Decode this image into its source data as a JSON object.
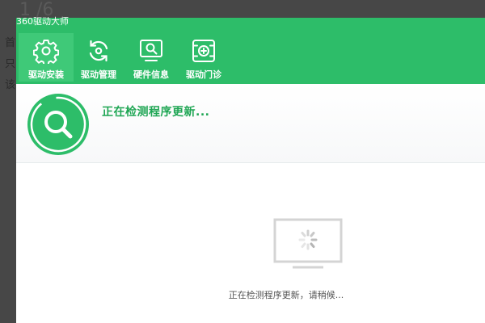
{
  "background_page": {
    "title": "1 /6",
    "lines": [
      "首",
      "只",
      "该"
    ]
  },
  "app": {
    "title": "360驱动大师",
    "nav": [
      {
        "label": "驱动安装",
        "icon": "gear-icon",
        "active": true
      },
      {
        "label": "驱动管理",
        "icon": "refresh-icon",
        "active": false
      },
      {
        "label": "硬件信息",
        "icon": "monitor-search-icon",
        "active": false
      },
      {
        "label": "驱动门诊",
        "icon": "medical-box-icon",
        "active": false
      }
    ],
    "status": {
      "title": "正在检测程序更新..."
    },
    "loading": {
      "text": "正在检测程序更新，请稍候..."
    }
  },
  "colors": {
    "brand_green": "#2dbd69",
    "active_tab": "#3fc978",
    "status_text": "#1fa654"
  }
}
